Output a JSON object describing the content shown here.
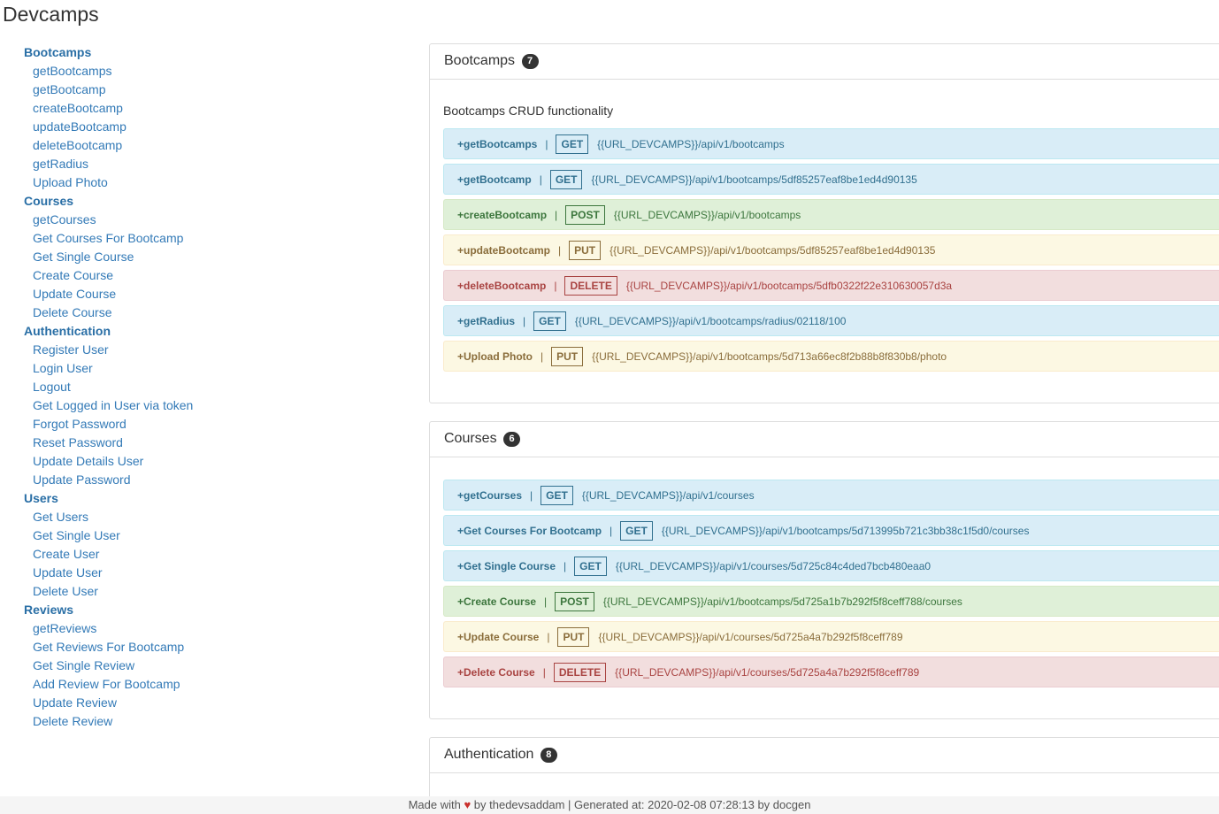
{
  "app_title": "Devcamps",
  "sidebar": {
    "groups": [
      {
        "label": "Bootcamps",
        "items": [
          "getBootcamps",
          "getBootcamp",
          "createBootcamp",
          "updateBootcamp",
          "deleteBootcamp",
          "getRadius",
          "Upload Photo"
        ]
      },
      {
        "label": "Courses",
        "items": [
          "getCourses",
          "Get Courses For Bootcamp",
          "Get Single Course",
          "Create Course",
          "Update Course",
          "Delete Course"
        ]
      },
      {
        "label": "Authentication",
        "items": [
          "Register User",
          "Login User",
          "Logout",
          "Get Logged in User via token",
          "Forgot Password",
          "Reset Password",
          "Update Details User",
          "Update Password"
        ]
      },
      {
        "label": "Users",
        "items": [
          "Get Users",
          "Get Single User",
          "Create User",
          "Update User",
          "Delete User"
        ]
      },
      {
        "label": "Reviews",
        "items": [
          "getReviews",
          "Get Reviews For Bootcamp",
          "Get Single Review",
          "Add Review For Bootcamp",
          "Update Review",
          "Delete Review"
        ]
      }
    ]
  },
  "sections": {
    "bootcamps": {
      "title": "Bootcamps",
      "count": "7",
      "description": "Bootcamps CRUD functionality",
      "endpoints": [
        {
          "name": "+getBootcamps",
          "method": "GET",
          "url": "{{URL_DEVCAMPS}}/api/v1/bootcamps"
        },
        {
          "name": "+getBootcamp",
          "method": "GET",
          "url": "{{URL_DEVCAMPS}}/api/v1/bootcamps/5df85257eaf8be1ed4d90135"
        },
        {
          "name": "+createBootcamp",
          "method": "POST",
          "url": "{{URL_DEVCAMPS}}/api/v1/bootcamps"
        },
        {
          "name": "+updateBootcamp",
          "method": "PUT",
          "url": "{{URL_DEVCAMPS}}/api/v1/bootcamps/5df85257eaf8be1ed4d90135"
        },
        {
          "name": "+deleteBootcamp",
          "method": "DELETE",
          "url": "{{URL_DEVCAMPS}}/api/v1/bootcamps/5dfb0322f22e310630057d3a"
        },
        {
          "name": "+getRadius",
          "method": "GET",
          "url": "{{URL_DEVCAMPS}}/api/v1/bootcamps/radius/02118/100"
        },
        {
          "name": "+Upload Photo",
          "method": "PUT",
          "url": "{{URL_DEVCAMPS}}/api/v1/bootcamps/5d713a66ec8f2b88b8f830b8/photo"
        }
      ]
    },
    "courses": {
      "title": "Courses",
      "count": "6",
      "endpoints": [
        {
          "name": "+getCourses",
          "method": "GET",
          "url": "{{URL_DEVCAMPS}}/api/v1/courses"
        },
        {
          "name": "+Get Courses For Bootcamp",
          "method": "GET",
          "url": "{{URL_DEVCAMPS}}/api/v1/bootcamps/5d713995b721c3bb38c1f5d0/courses"
        },
        {
          "name": "+Get Single Course",
          "method": "GET",
          "url": "{{URL_DEVCAMPS}}/api/v1/courses/5d725c84c4ded7bcb480eaa0"
        },
        {
          "name": "+Create Course",
          "method": "POST",
          "url": "{{URL_DEVCAMPS}}/api/v1/bootcamps/5d725a1b7b292f5f8ceff788/courses"
        },
        {
          "name": "+Update Course",
          "method": "PUT",
          "url": "{{URL_DEVCAMPS}}/api/v1/courses/5d725a4a7b292f5f8ceff789"
        },
        {
          "name": "+Delete Course",
          "method": "DELETE",
          "url": "{{URL_DEVCAMPS}}/api/v1/courses/5d725a4a7b292f5f8ceff789"
        }
      ]
    },
    "authentication": {
      "title": "Authentication",
      "count": "8"
    }
  },
  "footer": {
    "made_with": "Made with",
    "by_author": "by thedevsaddam | Generated at: 2020-02-08 07:28:13 by docgen"
  },
  "colors": {
    "GET": "#d9edf7",
    "POST": "#dff0d8",
    "PUT": "#fcf8e3",
    "DELETE": "#f2dede",
    "link": "#337ab7"
  }
}
